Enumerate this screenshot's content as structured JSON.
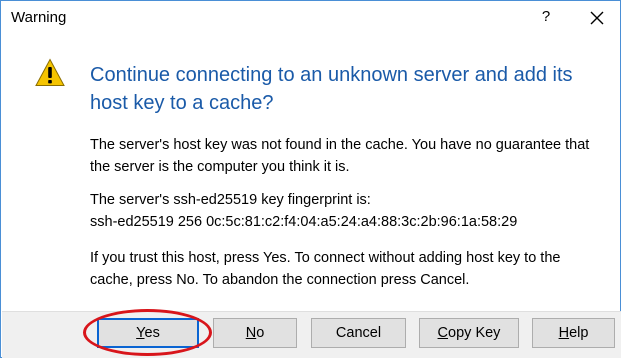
{
  "window": {
    "title": "Warning",
    "help_glyph": "?",
    "close_icon": "close-icon"
  },
  "icon": {
    "name": "warning-icon",
    "color": "#f5c400"
  },
  "message": {
    "heading_lines": [
      "Continue connecting to an unknown server and add its",
      "host key to a cache?"
    ],
    "paragraph1_lines": [
      "The server's host key was not found in the cache. You have no guarantee that",
      "the server is the computer you think it is."
    ],
    "paragraph2_lines": [
      "The server's ssh-ed25519 key fingerprint is:",
      "ssh-ed25519 256 0c:5c:81:c2:f4:04:a5:24:a4:88:3c:2b:96:1a:58:29"
    ],
    "paragraph3_lines": [
      "If you trust this host, press Yes. To connect without adding host key to the",
      "cache, press No. To abandon the connection press Cancel."
    ]
  },
  "buttons": {
    "yes": {
      "accel": "Y",
      "rest": "es"
    },
    "no": {
      "accel": "N",
      "rest": "o"
    },
    "cancel": {
      "label": "Cancel"
    },
    "copy_key": {
      "accel": "C",
      "rest": "opy Key"
    },
    "help": {
      "accel": "H",
      "rest": "elp"
    }
  },
  "colors": {
    "heading": "#1a5aa8",
    "highlight_circle": "#d8151b",
    "default_button_border": "#0a64d2"
  }
}
